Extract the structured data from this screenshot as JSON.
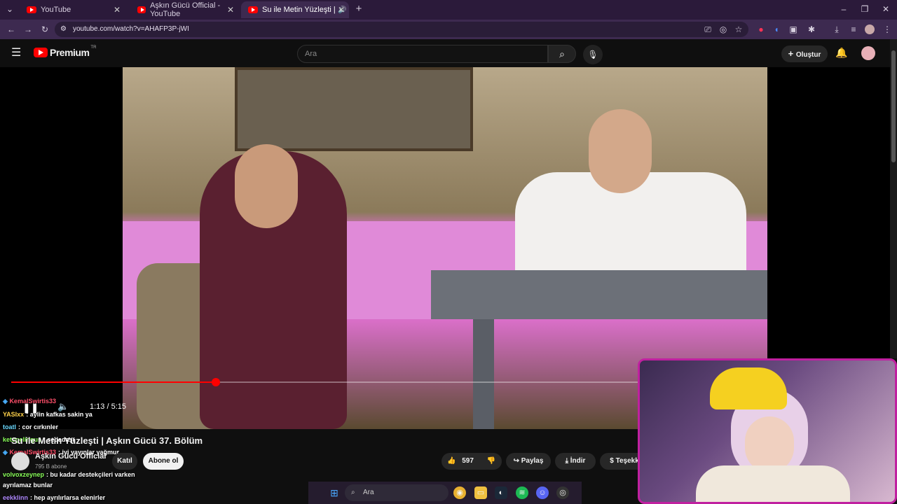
{
  "browser": {
    "tabs": [
      {
        "label": "YouTube"
      },
      {
        "label": "Aşkın Gücü Official - YouTube"
      },
      {
        "label": "Su ile Metin Yüzleşti | Aşkın"
      }
    ],
    "url": "youtube.com/watch?v=AHAFP3P-jWI"
  },
  "youtube": {
    "logo": "Premium",
    "logo_region": "TR",
    "search_placeholder": "Ara",
    "create_label": "Oluştur",
    "video": {
      "time": "1:13 / 5:15",
      "progress": 0.232,
      "title": "Su ile Metin Yüzleşti | Aşkın Gücü 37. Bölüm"
    },
    "channel": {
      "name": "Aşkın Gücü Official",
      "subs": "795 B abone",
      "join_label": "Katıl",
      "subscribe_label": "Abone ol"
    },
    "actions": {
      "likes": "597",
      "share_label": "Paylaş",
      "download_label": "İndir",
      "thanks_label": "Teşekk"
    }
  },
  "chat": [
    {
      "user": "KemalSwirtis33",
      "text": "",
      "color": "#ff4f6a"
    },
    {
      "user": "YASIxx",
      "text": ": aylin kafkas sakin ya",
      "color": "#ffd24a"
    },
    {
      "user": "toatl",
      "text": ": cor cırkınler",
      "color": "#6ad9ff"
    },
    {
      "user": "ketcgelingus",
      "text": ": sedadaşı",
      "color": "#8aff5a"
    },
    {
      "user": "KemalSwirtis33",
      "text": ": iyi yayınlar yağmur",
      "color": "#ff4f6a"
    },
    {
      "user": "volvoxzeynep",
      "text": ": bu kadar destekçileri varken",
      "color": "#8aff5a"
    },
    {
      "user": "",
      "text": "ayrılamaz bunlar",
      "color": "#ffffff"
    },
    {
      "user": "eekklinn",
      "text": ": hep ayrılırlarsa elenirler",
      "color": "#b18aff"
    }
  ],
  "taskbar": {
    "search_placeholder": "Ara"
  },
  "colors": {
    "accent": "#ff0000",
    "tab_bar": "#2b1a3a",
    "webcam_border": "#c020a0"
  }
}
